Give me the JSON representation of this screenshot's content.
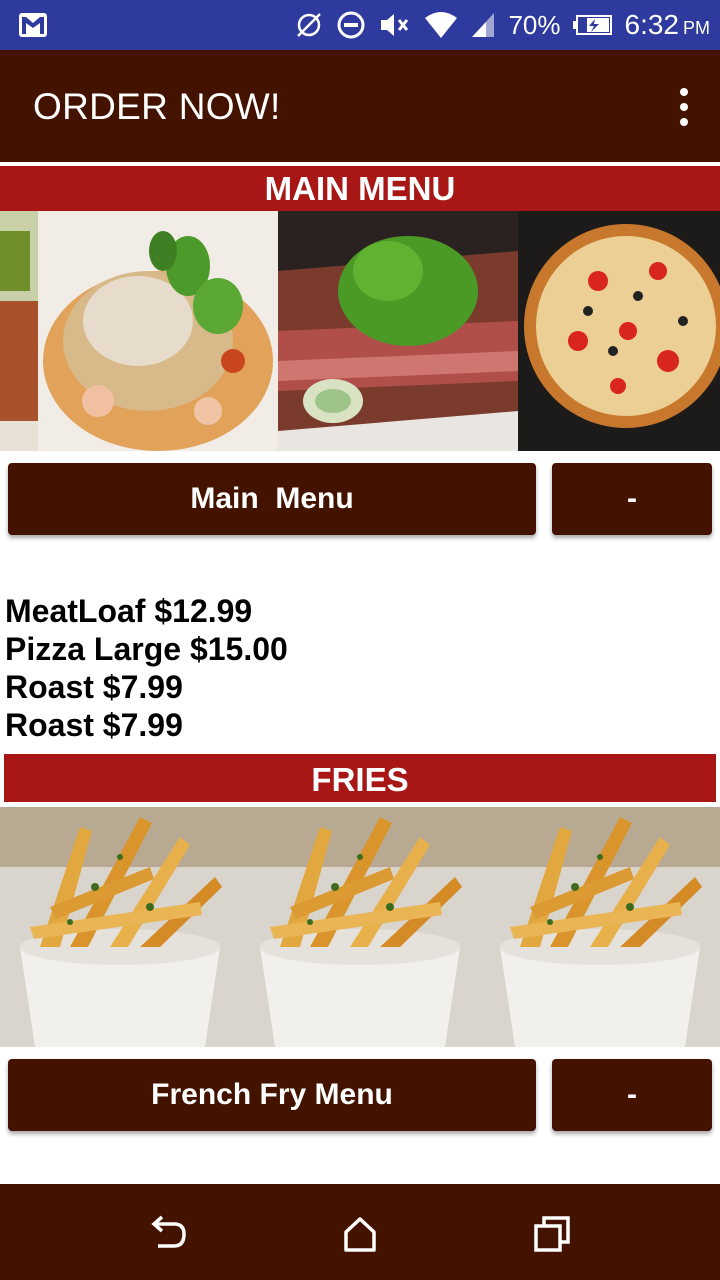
{
  "status_bar": {
    "battery_percent": "70%",
    "time": "6:32",
    "ampm": "PM"
  },
  "app_bar": {
    "title": "ORDER NOW!"
  },
  "sections": {
    "main": {
      "header": "MAIN MENU",
      "button_label": "Main  Menu",
      "minus_label": "-"
    },
    "fries": {
      "header": "FRIES",
      "button_label": "French Fry Menu",
      "minus_label": "-"
    }
  },
  "order_items": [
    "MeatLoaf $12.99",
    "Pizza Large $15.00",
    "Roast $7.99",
    "Roast $7.99"
  ],
  "icons": {
    "status_left": "gmail-icon",
    "nav": [
      "back-icon",
      "home-icon",
      "recent-apps-icon"
    ]
  },
  "colors": {
    "status_bar": "#2f3a9e",
    "primary_dark": "#431300",
    "section_red": "#a81616"
  }
}
